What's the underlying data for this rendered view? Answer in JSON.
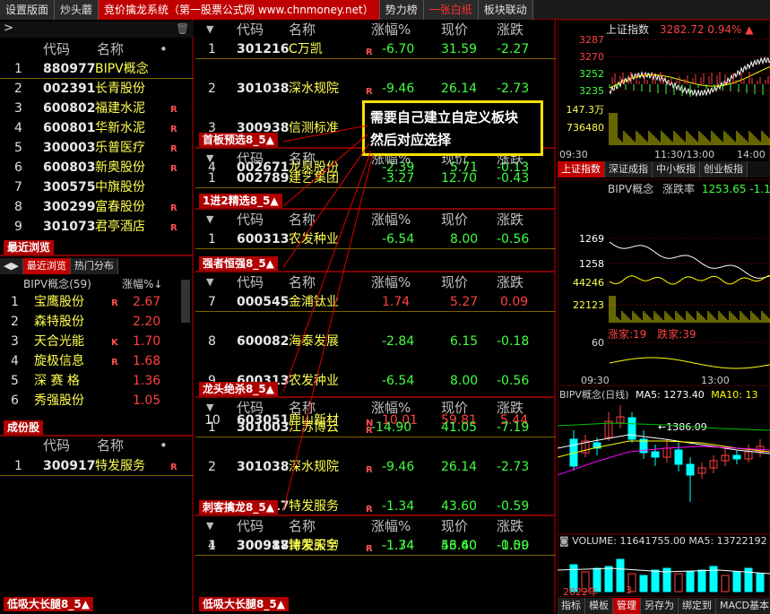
{
  "top_tabs": [
    "设置版面",
    "炒头蘑",
    "竞价擒龙系统（第一股票公式网 www.chnmoney.net）",
    "势力榜",
    "一张白纸",
    "板块联动"
  ],
  "left": {
    "arrow": ">",
    "header": {
      "code": "代码",
      "name": "名称",
      "dot": "•"
    },
    "rows": [
      {
        "idx": "1",
        "code": "880977",
        "name": "BIPV概念",
        "badge": ""
      },
      {
        "idx": "2",
        "code": "002391",
        "name": "长青股份",
        "badge": ""
      },
      {
        "idx": "3",
        "code": "600802",
        "name": "福建水泥",
        "badge": "R"
      },
      {
        "idx": "4",
        "code": "600801",
        "name": "华新水泥",
        "badge": "R"
      },
      {
        "idx": "5",
        "code": "300003",
        "name": "乐普医疗",
        "badge": "R"
      },
      {
        "idx": "6",
        "code": "600803",
        "name": "新奥股份",
        "badge": "R"
      },
      {
        "idx": "7",
        "code": "300575",
        "name": "中旗股份",
        "badge": ""
      },
      {
        "idx": "8",
        "code": "300299",
        "name": "富春股份",
        "badge": "R"
      },
      {
        "idx": "9",
        "code": "301073",
        "name": "君亭酒店",
        "badge": "R"
      }
    ],
    "recent_label": "最近浏览",
    "subtabs": [
      "最近浏览",
      "热门分布"
    ],
    "sector_title": "BIPV概念(59)",
    "sector_col": "涨幅%↓",
    "sector_rows": [
      {
        "idx": "1",
        "name": "宝鹰股份",
        "badge": "R",
        "val": "2.67"
      },
      {
        "idx": "2",
        "name": "森特股份",
        "badge": "",
        "val": "2.20"
      },
      {
        "idx": "3",
        "name": "天合光能",
        "badge": "K",
        "val": "1.70"
      },
      {
        "idx": "4",
        "name": "旋极信息",
        "badge": "R",
        "val": "1.68"
      },
      {
        "idx": "5",
        "name": "深 赛 格",
        "badge": "",
        "val": "1.36"
      },
      {
        "idx": "6",
        "name": "秀强股份",
        "badge": "",
        "val": "1.05"
      }
    ],
    "component_label": "成份股",
    "comp_header": {
      "code": "代码",
      "name": "名称",
      "dot": "•"
    },
    "comp_rows": [
      {
        "idx": "1",
        "code": "300917",
        "name": "特发服务",
        "badge": "R"
      }
    ],
    "bottom_label": "低吸大长腿8_5▲"
  },
  "mid": {
    "header": {
      "code": "代码",
      "name": "名称",
      "chg": "涨幅%",
      "price": "现价",
      "diff": "涨跌"
    },
    "sections": [
      {
        "label": "首板预选8_5▲",
        "rows": [
          {
            "idx": "1",
            "code": "301216",
            "name": "C万凯",
            "badge": "R",
            "chg": "-6.70",
            "price": "31.59",
            "diff": "-2.27"
          },
          {
            "idx": "2",
            "code": "301038",
            "name": "深水规院",
            "badge": "R",
            "chg": "-9.46",
            "price": "26.14",
            "diff": "-2.73"
          },
          {
            "idx": "3",
            "code": "300938",
            "name": "信测标准",
            "badge": "R",
            "chg": "-7.08",
            "price": "46.62",
            "diff": "-3.55"
          },
          {
            "idx": "4",
            "code": "002671",
            "name": "龙泉股份",
            "badge": "",
            "chg": "-2.39",
            "price": "5.71",
            "diff": "-0.13"
          }
        ]
      },
      {
        "label": "1进2精选8_5▲",
        "rows": [
          {
            "idx": "1",
            "code": "002789",
            "name": "建艺集团",
            "badge": "",
            "chg": "-3.27",
            "price": "12.70",
            "diff": "-0.43"
          }
        ]
      },
      {
        "label": "强者恒强8_5▲",
        "rows": [
          {
            "idx": "1",
            "code": "600313",
            "name": "农发种业",
            "badge": "",
            "chg": "-6.54",
            "price": "8.00",
            "diff": "-0.56"
          }
        ]
      },
      {
        "label": "龙头绝杀8_5▲",
        "rows": [
          {
            "idx": "7",
            "code": "000545",
            "name": "金浦钛业",
            "badge": "",
            "chg": "1.74",
            "price": "5.27",
            "diff": "0.09"
          },
          {
            "idx": "8",
            "code": "600082",
            "name": "海泰发展",
            "badge": "",
            "chg": "-2.84",
            "price": "6.15",
            "diff": "-0.18"
          },
          {
            "idx": "9",
            "code": "600313",
            "name": "农发种业",
            "badge": "",
            "chg": "-6.54",
            "price": "8.00",
            "diff": "-0.56"
          },
          {
            "idx": "10",
            "code": "603051",
            "name": "鹿山新材",
            "badge": "N",
            "chg": "10.01",
            "price": "59.81",
            "diff": "5.44"
          }
        ]
      },
      {
        "label": "刺客擒龙8_5▲",
        "rows": [
          {
            "idx": "1",
            "code": "301003",
            "name": "江苏博云",
            "badge": "R",
            "chg": "-14.90",
            "price": "41.05",
            "diff": "-7.19"
          },
          {
            "idx": "2",
            "code": "301038",
            "name": "深水规院",
            "badge": "R",
            "chg": "-9.46",
            "price": "26.14",
            "diff": "-2.73"
          },
          {
            "idx": "3",
            "code": "300917",
            "name": "特发服务",
            "badge": "R",
            "chg": "-1.34",
            "price": "43.60",
            "diff": "-0.59"
          },
          {
            "idx": "4",
            "code": "300988",
            "name": "津荣天宇",
            "badge": "R",
            "chg": "-1.74",
            "price": "56.40",
            "diff": "-1.00"
          }
        ]
      },
      {
        "label": "低吸大长腿8_5▲",
        "rows": [
          {
            "idx": "1",
            "code": "300917",
            "name": "特发服务",
            "badge": "R",
            "chg": "-1.34",
            "price": "43.60",
            "diff": "-0.59"
          }
        ]
      }
    ],
    "callout_lines": [
      "需要自己建立自定义板块",
      "然后对应选择"
    ]
  },
  "right": {
    "index_title": "上证指数",
    "index_values": "3282.72 0.94% ▲",
    "index_price_ticks": [
      "3287",
      "3270",
      "3252",
      "3235"
    ],
    "index_vol_ticks": [
      "147.3万",
      "736480"
    ],
    "index_time_ticks": [
      "09:30",
      "11:30/13:00",
      "14:00"
    ],
    "index_tabs": [
      "上证指数",
      "深证成指",
      "中小板指",
      "创业板指"
    ],
    "sector_title": "BIPV概念",
    "sector_rate_label": "涨跌率",
    "sector_rate_value": "1253.65 -1.19%",
    "sector_ticks": [
      "1269",
      "1258",
      "44246",
      "22123",
      "60"
    ],
    "up_count": "涨家:19",
    "down_count": "跌家:39",
    "sector_time_ticks": [
      "09:30",
      "13:00"
    ],
    "kline_title": "BIPV概念(日线)",
    "ma5": "MA5: 1273.40",
    "ma10": "MA10: 13",
    "kline_high": "1386.09",
    "volume_text": "VOLUME: 11641755.00 MA5: 13722192",
    "year_label": "2022年",
    "month_label": "3",
    "bottom_tabs": [
      "指标",
      "模板",
      "管理",
      "另存为",
      "绑定到",
      "MACD基本"
    ],
    "colors": {
      "up": "#ff4040",
      "down": "#00ffff",
      "ma5": "#ffffff",
      "ma10": "#ffff00",
      "ma20": "#ff00ff",
      "ma60": "#00ff00"
    }
  }
}
